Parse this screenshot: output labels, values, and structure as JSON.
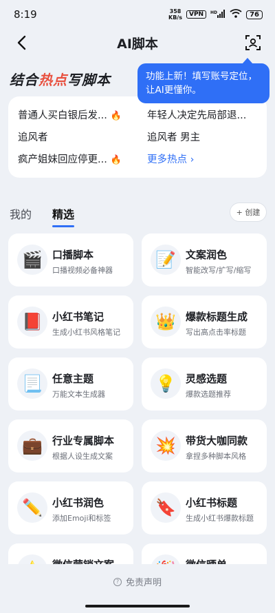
{
  "status": {
    "time": "8:19",
    "speed": "358",
    "speed_unit": "KB/s",
    "vpn": "VPN",
    "signal": "HD",
    "battery": "76"
  },
  "nav": {
    "title": "AI脚本"
  },
  "tooltip": {
    "line1": "功能上新！填写账号定位，",
    "line2": "让AI更懂你。"
  },
  "hot": {
    "title_a": "结合",
    "title_b": "热点",
    "title_c": "写脚本",
    "left": [
      {
        "text": "普通人买白银后发...",
        "fire": "🔥"
      },
      {
        "text": "追风者",
        "fire": ""
      },
      {
        "text": "疯产姐妹回应停更...",
        "fire": "🔥"
      }
    ],
    "right": [
      {
        "text": "年轻人决定先局部退..."
      },
      {
        "text": "追风者 男主"
      }
    ],
    "more": "更多热点 ›"
  },
  "tabs": {
    "mine": "我的",
    "featured": "精选",
    "create": "+ 创建"
  },
  "cards": [
    {
      "title": "口播脚本",
      "subtitle": "口播视频必备神器",
      "icon": "clapperboard-icon",
      "glyph": "🎬"
    },
    {
      "title": "文案润色",
      "subtitle": "智能改写/扩写/缩写",
      "icon": "memo-icon",
      "glyph": "📝"
    },
    {
      "title": "小红书笔记",
      "subtitle": "生成小红书风格笔记",
      "icon": "red-book-icon",
      "glyph": "📕"
    },
    {
      "title": "爆款标题生成",
      "subtitle": "写出高点击率标题",
      "icon": "crown-icon",
      "glyph": "👑"
    },
    {
      "title": "任意主题",
      "subtitle": "万能文本生成器",
      "icon": "page-icon",
      "glyph": "📃"
    },
    {
      "title": "灵感选题",
      "subtitle": "爆款选题推荐",
      "icon": "lightbulb-icon",
      "glyph": "💡"
    },
    {
      "title": "行业专属脚本",
      "subtitle": "根据人设生成文案",
      "icon": "briefcase-icon",
      "glyph": "💼"
    },
    {
      "title": "带货大咖同款",
      "subtitle": "拿捏多种脚本风格",
      "icon": "burst-icon",
      "glyph": "💥"
    },
    {
      "title": "小红书润色",
      "subtitle": "添加Emoji和标签",
      "icon": "pencil-icon",
      "glyph": "✏️"
    },
    {
      "title": "小红书标题",
      "subtitle": "生成小红书爆款标题",
      "icon": "tag-icon",
      "glyph": "🔖"
    },
    {
      "title": "微信营销文案",
      "subtitle": "",
      "icon": "star-icon",
      "glyph": "⭐"
    },
    {
      "title": "微信晒单",
      "subtitle": "",
      "icon": "party-icon",
      "glyph": "🎉"
    }
  ],
  "footer": {
    "disclaimer": "免责声明"
  }
}
